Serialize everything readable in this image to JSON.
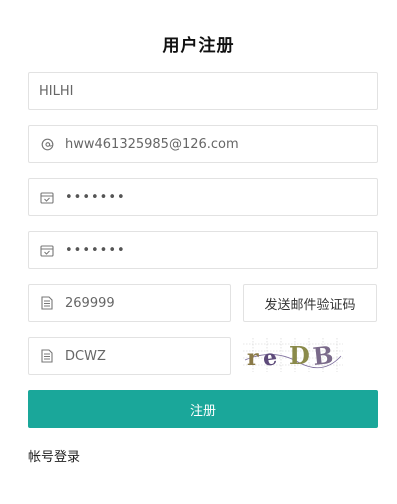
{
  "form": {
    "title": "用户注册",
    "username_value": "HILHI",
    "email_value": "hww461325985@126.com",
    "password_value": "•••••••",
    "confirm_password_value": "•••••••",
    "email_code_value": "269999",
    "send_code_label": "发送邮件验证码",
    "captcha_value": "DCWZ",
    "captcha_image_text": "reDB",
    "submit_label": "注册",
    "login_link_label": "帐号登录"
  },
  "colors": {
    "accent": "#1aa79a",
    "border": "#e2e2e2",
    "input_text": "#666666"
  },
  "icons": {
    "email": "at-sign-icon",
    "password": "lock-icon",
    "confirm_password": "lock-icon",
    "email_code": "document-icon",
    "captcha": "document-icon"
  }
}
